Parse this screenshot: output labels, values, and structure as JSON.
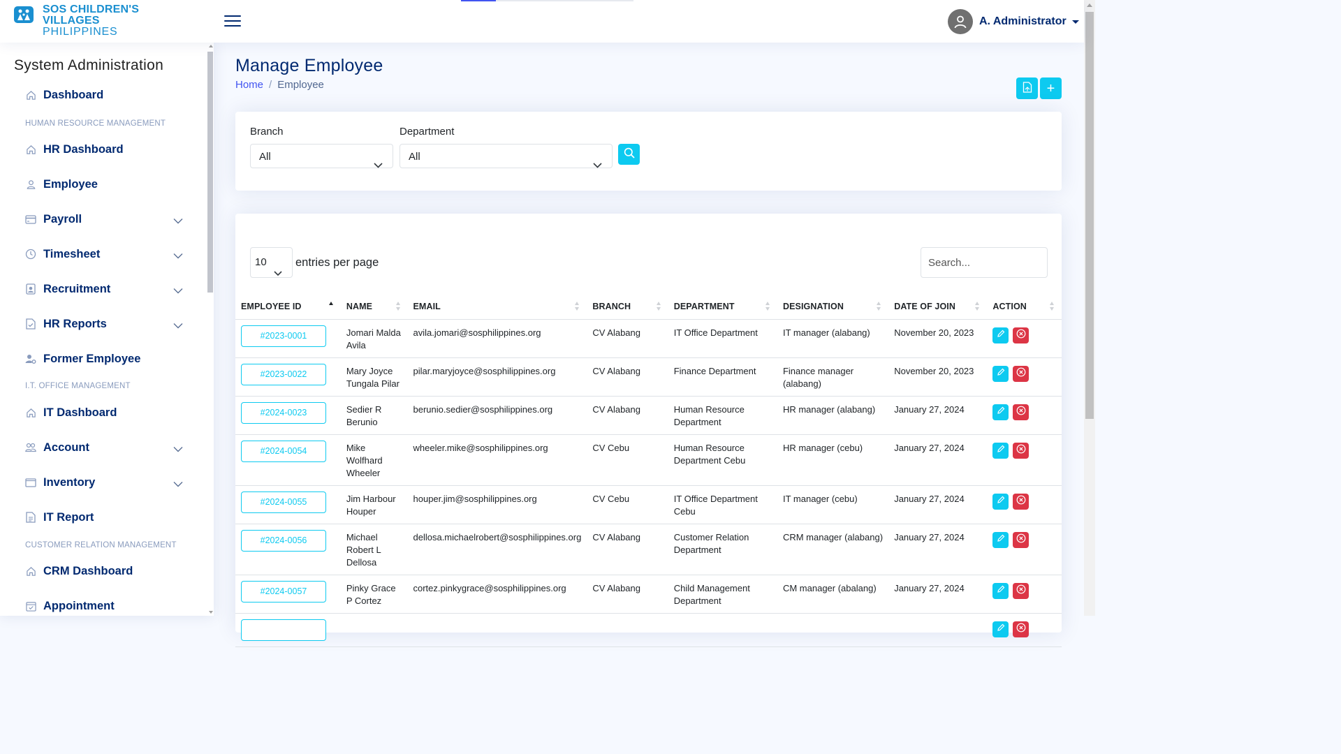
{
  "brand": {
    "line1": "SOS CHILDREN'S",
    "line2": "VILLAGES",
    "line3": "PHILIPPINES",
    "color": "#1a8fd0"
  },
  "user": {
    "name": "A. Administrator"
  },
  "sidebar": {
    "title": "System Administration",
    "headings": {
      "hr": "HUMAN RESOURCE MANAGEMENT",
      "it": "I.T. OFFICE MANAGEMENT",
      "crm": "CUSTOMER RELATION MANAGEMENT"
    },
    "items": [
      {
        "label": "Dashboard",
        "icon": "house-icon"
      },
      {
        "label": "HR Dashboard",
        "icon": "house-icon"
      },
      {
        "label": "Employee",
        "icon": "person-icon"
      },
      {
        "label": "Payroll",
        "icon": "credit-card-icon",
        "expandable": true
      },
      {
        "label": "Timesheet",
        "icon": "clock-icon",
        "expandable": true
      },
      {
        "label": "Recruitment",
        "icon": "person-badge-icon",
        "expandable": true
      },
      {
        "label": "HR Reports",
        "icon": "file-check-icon",
        "expandable": true
      },
      {
        "label": "Former Employee",
        "icon": "person-gear-icon"
      },
      {
        "label": "IT Dashboard",
        "icon": "house-icon"
      },
      {
        "label": "Account",
        "icon": "people-icon",
        "expandable": true
      },
      {
        "label": "Inventory",
        "icon": "window-icon",
        "expandable": true
      },
      {
        "label": "IT Report",
        "icon": "file-text-icon"
      },
      {
        "label": "CRM Dashboard",
        "icon": "house-icon"
      },
      {
        "label": "Appointment",
        "icon": "calendar-check-icon"
      }
    ]
  },
  "page": {
    "title": "Manage Employee",
    "breadcrumb": {
      "home": "Home",
      "separator": "/",
      "current": "Employee"
    },
    "add_button": "+"
  },
  "filters": {
    "branch_label": "Branch",
    "branch_value": "All",
    "department_label": "Department",
    "department_value": "All"
  },
  "table": {
    "per_page_value": "10",
    "per_page_label": "entries per page",
    "search_placeholder": "Search...",
    "columns": [
      "EMPLOYEE ID",
      "NAME",
      "EMAIL",
      "BRANCH",
      "DEPARTMENT",
      "DESIGNATION",
      "DATE OF JOIN",
      "ACTION"
    ],
    "rows": [
      {
        "id": "#2023-0001",
        "name": "Jomari Malda Avila",
        "email": "avila.jomari@sosphilippines.org",
        "branch": "CV Alabang",
        "department": "IT Office Department",
        "designation": "IT manager (alabang)",
        "date": "November 20, 2023"
      },
      {
        "id": "#2023-0022",
        "name": "Mary Joyce Tungala Pilar",
        "email": "pilar.maryjoyce@sosphilippines.org",
        "branch": "CV Alabang",
        "department": "Finance Department",
        "designation": "Finance manager (alabang)",
        "date": "November 20, 2023"
      },
      {
        "id": "#2024-0023",
        "name": "Sedier R Berunio",
        "email": "berunio.sedier@sosphilippines.org",
        "branch": "CV Alabang",
        "department": "Human Resource Department",
        "designation": "HR manager (alabang)",
        "date": "January 27, 2024"
      },
      {
        "id": "#2024-0054",
        "name": "Mike Wolfhard Wheeler",
        "email": "wheeler.mike@sosphilippines.org",
        "branch": "CV Cebu",
        "department": "Human Resource Department Cebu",
        "designation": "HR manager (cebu)",
        "date": "January 27, 2024"
      },
      {
        "id": "#2024-0055",
        "name": "Jim Harbour Houper",
        "email": "houper.jim@sosphilippines.org",
        "branch": "CV Cebu",
        "department": "IT Office Department Cebu",
        "designation": "IT manager (cebu)",
        "date": "January 27, 2024"
      },
      {
        "id": "#2024-0056",
        "name": "Michael Robert L Dellosa",
        "email": "dellosa.michaelrobert@sosphilippines.org",
        "branch": "CV Alabang",
        "department": "Customer Relation Department",
        "designation": "CRM manager (alabang)",
        "date": "January 27, 2024"
      },
      {
        "id": "#2024-0057",
        "name": "Pinky Grace P Cortez",
        "email": "cortez.pinkygrace@sosphilippines.org",
        "branch": "CV Alabang",
        "department": "Child Management Department",
        "designation": "CM manager (abalang)",
        "date": "January 27, 2024"
      },
      {
        "id": "",
        "name": "",
        "email": "",
        "branch": "",
        "department": "",
        "designation": "",
        "date": ""
      }
    ]
  },
  "colors": {
    "primary": "#012970",
    "accent": "#0dcaf0",
    "danger": "#dc3545",
    "link": "#4154f1"
  }
}
